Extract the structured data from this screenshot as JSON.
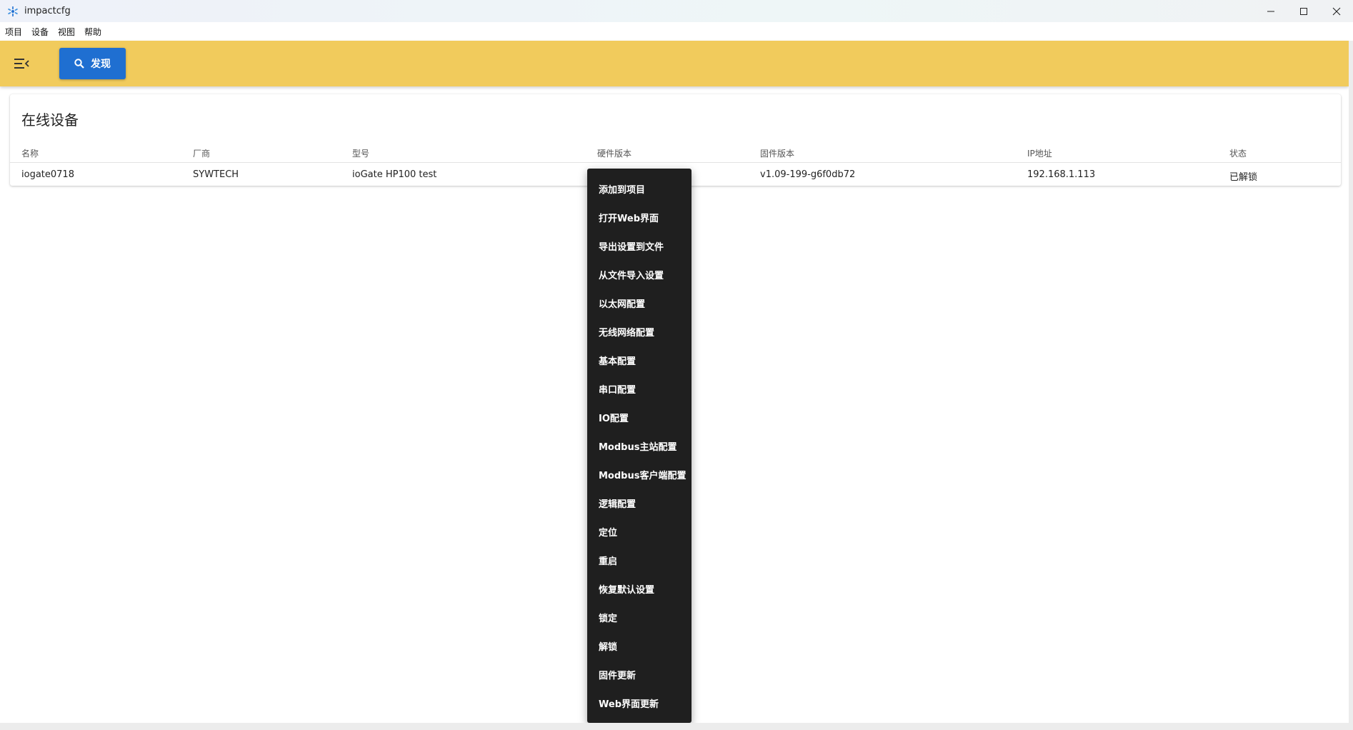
{
  "window": {
    "title": "impactcfg",
    "controls": [
      "minimize-icon",
      "maximize-icon",
      "close-icon"
    ]
  },
  "menubar": {
    "items": [
      "项目",
      "设备",
      "视图",
      "帮助"
    ]
  },
  "toolbar": {
    "menu_icon": "hamburger-collapse-icon",
    "discover_label": "发现",
    "discover_icon": "search-icon",
    "accent_color": "#f1cb5c",
    "button_color": "#1f6fd1"
  },
  "devices": {
    "title": "在线设备",
    "columns": [
      "名称",
      "厂商",
      "型号",
      "硬件版本",
      "固件版本",
      "IP地址",
      "状态"
    ],
    "rows": [
      {
        "name": "iogate0718",
        "vendor": "SYWTECH",
        "model": "ioGate HP100 test",
        "hardware": "",
        "firmware": "v1.09-199-g6f0db72",
        "ip": "192.168.1.113",
        "status": "已解锁"
      }
    ]
  },
  "context_menu": {
    "items": [
      "添加到项目",
      "打开Web界面",
      "导出设置到文件",
      "从文件导入设置",
      "以太网配置",
      "无线网络配置",
      "基本配置",
      "串口配置",
      "IO配置",
      "Modbus主站配置",
      "Modbus客户端配置",
      "逻辑配置",
      "定位",
      "重启",
      "恢复默认设置",
      "锁定",
      "解锁",
      "固件更新",
      "Web界面更新"
    ]
  }
}
